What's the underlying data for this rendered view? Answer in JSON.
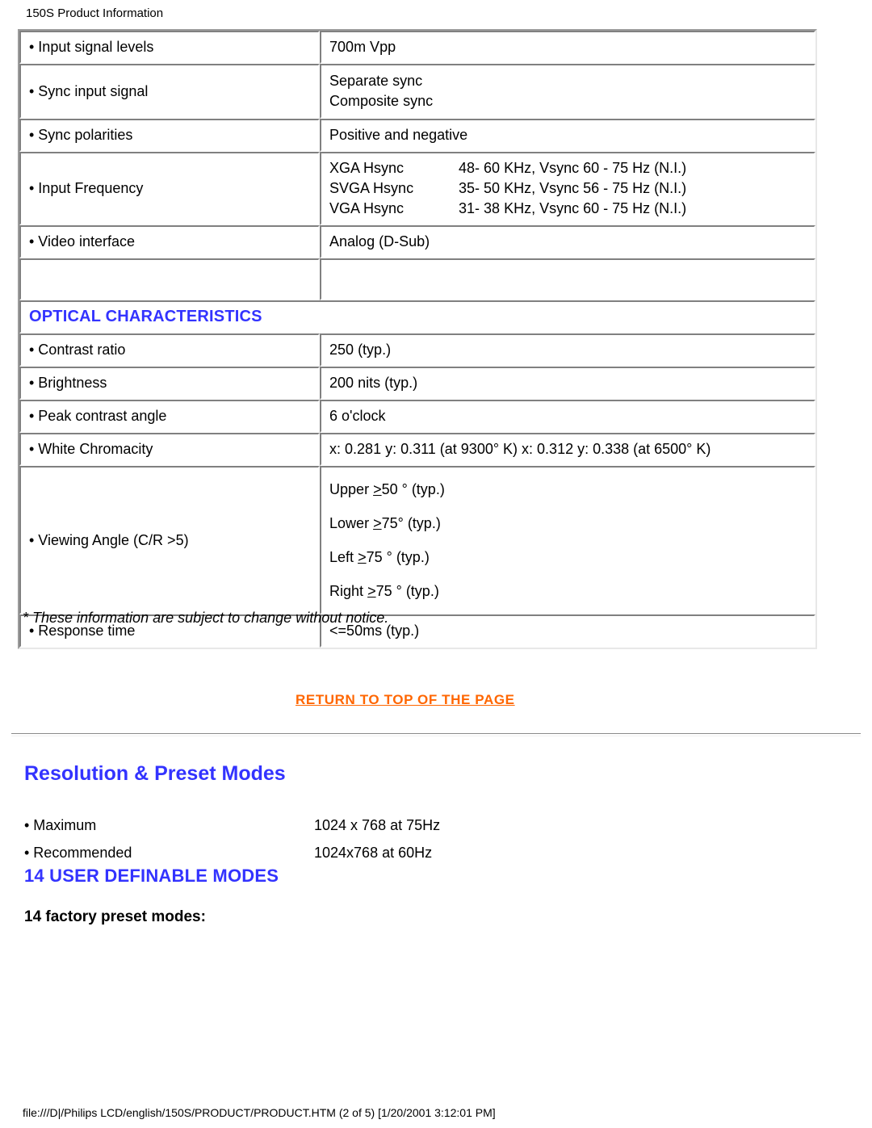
{
  "header": {
    "title": "150S Product Information"
  },
  "spec_table": {
    "rows": [
      {
        "label": "• Input signal levels",
        "value": "700m Vpp",
        "kind": "normal"
      },
      {
        "label": "• Sync input signal",
        "value": "Separate sync\nComposite sync",
        "kind": "tall"
      },
      {
        "label": "• Sync polarities",
        "value": "Positive and negative",
        "kind": "normal"
      },
      {
        "label": "• Input Frequency",
        "kind": "frequency",
        "frequencies": [
          {
            "mode": "XGA Hsync",
            "range": "48- 60 KHz, Vsync 60 - 75 Hz (N.I.)"
          },
          {
            "mode": "SVGA Hsync",
            "range": "35- 50 KHz, Vsync 56 - 75 Hz (N.I.)"
          },
          {
            "mode": "VGA Hsync",
            "range": "31- 38 KHz, Vsync 60 - 75 Hz (N.I.)"
          }
        ]
      },
      {
        "label": "• Video interface",
        "value": "Analog (D-Sub)",
        "kind": "normal"
      },
      {
        "label": "",
        "value": "",
        "kind": "blank"
      },
      {
        "label": "OPTICAL CHARACTERISTICS",
        "kind": "section"
      },
      {
        "label": "• Contrast ratio",
        "value": "250 (typ.)",
        "kind": "normal"
      },
      {
        "label": "• Brightness",
        "value": "200 nits (typ.)",
        "kind": "normal"
      },
      {
        "label": "• Peak contrast angle",
        "value": "6 o'clock",
        "kind": "normal"
      },
      {
        "label": "• White Chromacity",
        "value": "x: 0.281 y: 0.311 (at 9300° K) x: 0.312 y: 0.338 (at 6500° K)",
        "kind": "normal"
      },
      {
        "label": "• Viewing Angle (C/R >5)",
        "kind": "angle",
        "angles": [
          {
            "direction": "Upper",
            "op": ">",
            "value": "50 ° (typ.)"
          },
          {
            "direction": "Lower",
            "op": ">",
            "value": "75° (typ.)"
          },
          {
            "direction": "Left",
            "op": ">",
            "value": "75 ° (typ.)"
          },
          {
            "direction": "Right",
            "op": ">",
            "value": "75 ° (typ.)"
          }
        ]
      },
      {
        "label": "• Response time",
        "value": "<=50ms (typ.)",
        "kind": "normal"
      }
    ]
  },
  "notice": "* These information are subject to change without notice.",
  "return_link": {
    "label": "RETURN TO TOP OF THE PAGE",
    "color": "#ff6600"
  },
  "resolution_section": {
    "title": "Resolution & Preset Modes",
    "title_color": "#3333ff",
    "rows": [
      {
        "label": "• Maximum",
        "value": "1024 x 768 at 75Hz"
      },
      {
        "label": "• Recommended",
        "value": "1024x768 at 60Hz"
      }
    ],
    "modes_heading": "14 USER DEFINABLE MODES",
    "factory_heading": "14 factory preset modes:"
  },
  "footer": {
    "path": "file:///D|/Philips LCD/english/150S/PRODUCT/PRODUCT.HTM (2 of 5) [1/20/2001 3:12:01 PM]"
  }
}
